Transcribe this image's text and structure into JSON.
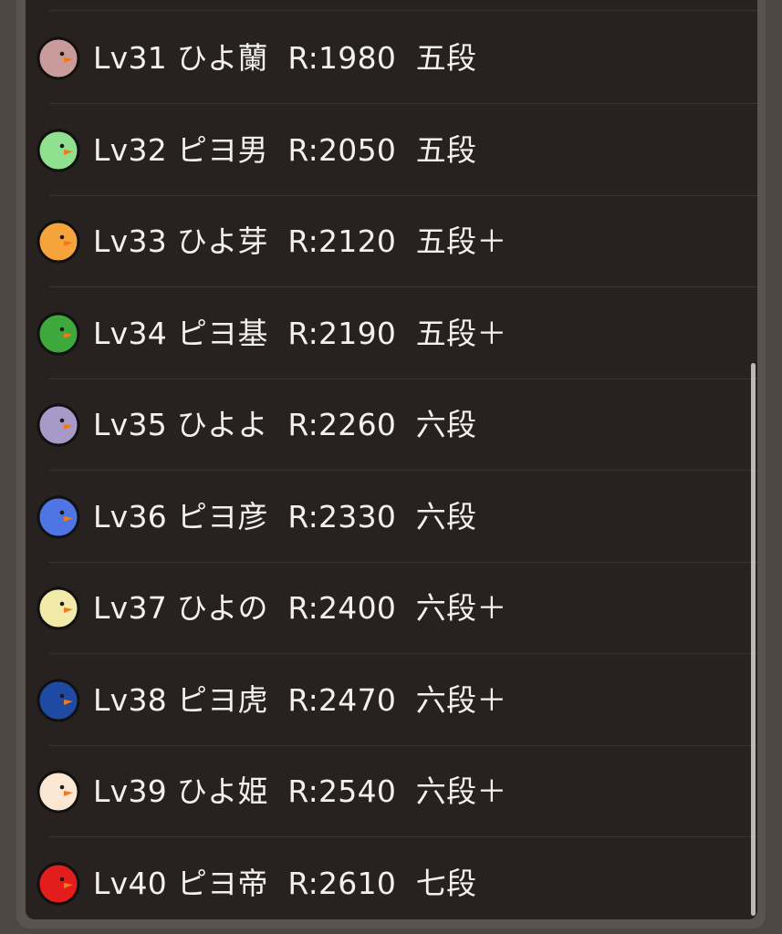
{
  "levels": [
    {
      "text": "Lv31 ひよ蘭  R:1980  五段",
      "color": "#c99a9a",
      "icon": "chick-icon"
    },
    {
      "text": "Lv32 ピヨ男  R:2050  五段",
      "color": "#8fe08f",
      "icon": "chick-icon"
    },
    {
      "text": "Lv33 ひよ芽  R:2120  五段＋",
      "color": "#f4a43a",
      "icon": "chick-icon"
    },
    {
      "text": "Lv34 ピヨ基  R:2190  五段＋",
      "color": "#3ea83c",
      "icon": "chick-icon"
    },
    {
      "text": "Lv35 ひよよ  R:2260  六段",
      "color": "#a89ac8",
      "icon": "chick-icon"
    },
    {
      "text": "Lv36 ピヨ彦  R:2330  六段",
      "color": "#4f74e3",
      "icon": "chick-icon"
    },
    {
      "text": "Lv37 ひよの  R:2400  六段＋",
      "color": "#f1eaa9",
      "icon": "chick-icon"
    },
    {
      "text": "Lv38 ピヨ虎  R:2470  六段＋",
      "color": "#1f4aa3",
      "icon": "chick-icon"
    },
    {
      "text": "Lv39 ひよ姫  R:2540  六段＋",
      "color": "#fbe6d4",
      "icon": "chick-icon"
    },
    {
      "text": "Lv40 ピヨ帝  R:2610  七段",
      "color": "#e31c1c",
      "icon": "chick-icon"
    }
  ],
  "colors": {
    "beak": "#f07a1a",
    "eye": "#1a1a1a",
    "outline": "#111111",
    "list_background": "#272120",
    "text": "#f3f1ef"
  }
}
